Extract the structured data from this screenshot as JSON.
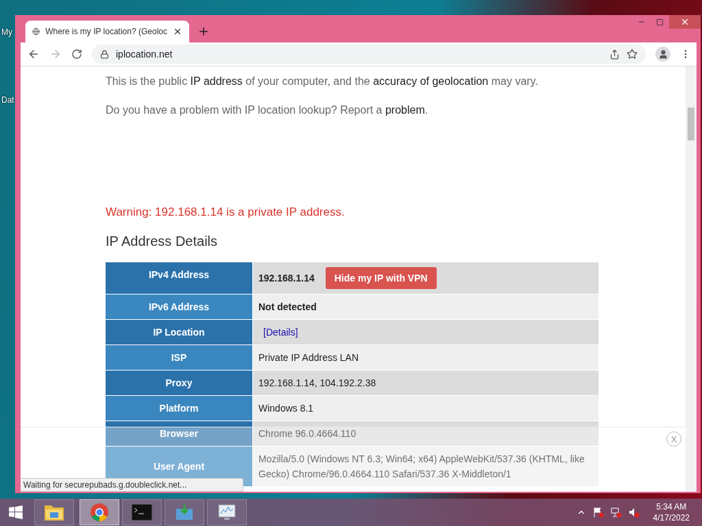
{
  "desktop": {
    "icons": [
      "My",
      "Dat"
    ]
  },
  "browser": {
    "tab": {
      "title": "Where is my IP location? (Geoloc"
    },
    "address": "iplocation.net"
  },
  "page": {
    "paragraphs": [
      [
        {
          "text": "This is the public ",
          "link": false
        },
        {
          "text": "IP address",
          "link": true
        },
        {
          "text": " of your computer, and the ",
          "link": false
        },
        {
          "text": "accuracy of geolocation",
          "link": true
        },
        {
          "text": " may vary.",
          "link": false
        }
      ],
      [
        {
          "text": "Do you have a problem with IP location lookup? Report a ",
          "link": false
        },
        {
          "text": "problem",
          "link": true
        },
        {
          "text": ".",
          "link": false
        }
      ]
    ],
    "warning": "Warning: 192.168.1.14 is a private IP address.",
    "heading": "IP Address Details",
    "rows": [
      {
        "label": "IPv4 Address",
        "kind": "ip",
        "value": "192.168.1.14",
        "bold": true,
        "button": "Hide my IP with VPN"
      },
      {
        "label": "IPv6 Address",
        "kind": "text",
        "value": "Not detected",
        "bold": true
      },
      {
        "label": "IP Location",
        "kind": "link",
        "value": "[Details]",
        "bold": false
      },
      {
        "label": "ISP",
        "kind": "text",
        "value": "Private IP Address LAN",
        "bold": false
      },
      {
        "label": "Proxy",
        "kind": "text",
        "value": "192.168.1.14, 104.192.2.38",
        "bold": false
      },
      {
        "label": "Platform",
        "kind": "text",
        "value": "Windows 8.1",
        "bold": false
      },
      {
        "label": "Browser",
        "kind": "text",
        "value": "Chrome 96.0.4664.110",
        "bold": false
      },
      {
        "label": "User Agent",
        "kind": "text",
        "value": "Mozilla/5.0 (Windows NT 6.3; Win64; x64) AppleWebKit/537.36 (KHTML, like Gecko) Chrome/96.0.4664.110 Safari/537.36 X-Middleton/1",
        "bold": false
      }
    ]
  },
  "overlay": {
    "close": "X"
  },
  "status": "Waiting for securepubads.g.doubleclick.net...",
  "taskbar": {
    "apps": [
      {
        "kind": "folder",
        "selected": false
      },
      {
        "kind": "chrome",
        "selected": true
      },
      {
        "kind": "console",
        "selected": false
      },
      {
        "kind": "installer",
        "selected": false
      },
      {
        "kind": "monitor",
        "selected": false
      }
    ],
    "time": "5:34 AM",
    "date": "4/17/2022"
  }
}
